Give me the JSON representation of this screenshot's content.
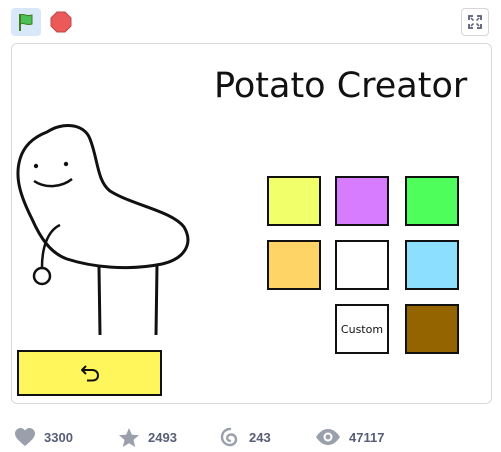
{
  "toolbar": {
    "green_flag_icon": "green-flag-icon",
    "stop_icon": "stop-sign-icon",
    "fullscreen_icon": "fullscreen-icon"
  },
  "stage": {
    "title": "Potato Creator",
    "character": "potato-character",
    "colors": [
      {
        "name": "yellow",
        "hex": "#f1ff6b"
      },
      {
        "name": "purple",
        "hex": "#d77cff"
      },
      {
        "name": "green",
        "hex": "#4eff5b"
      },
      {
        "name": "orange",
        "hex": "#ffd467"
      },
      {
        "name": "white",
        "hex": "#ffffff"
      },
      {
        "name": "light-blue",
        "hex": "#8ddfff"
      },
      {
        "name": "brown",
        "hex": "#946400"
      }
    ],
    "custom_label": "Custom",
    "back_button_color": "#fef65b"
  },
  "stats": {
    "loves": "3300",
    "favorites": "2493",
    "remixes": "243",
    "views": "47117"
  }
}
